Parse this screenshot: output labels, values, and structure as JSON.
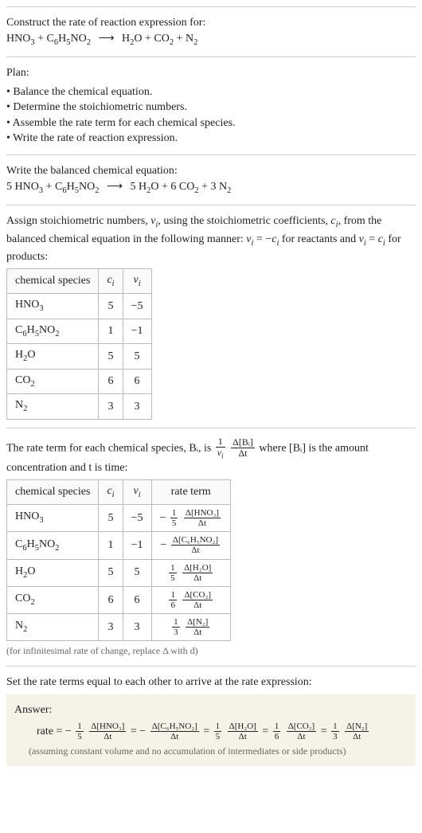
{
  "prompt": {
    "title": "Construct the rate of reaction expression for:",
    "equation": "HNO₃ + C₆H₅NO₂ ⟶ H₂O + CO₂ + N₂"
  },
  "plan": {
    "heading": "Plan:",
    "steps": [
      "Balance the chemical equation.",
      "Determine the stoichiometric numbers.",
      "Assemble the rate term for each chemical species.",
      "Write the rate of reaction expression."
    ]
  },
  "balanced": {
    "heading": "Write the balanced chemical equation:",
    "equation": "5 HNO₃ + C₆H₅NO₂ ⟶ 5 H₂O + 6 CO₂ + 3 N₂"
  },
  "stoich": {
    "intro": "Assign stoichiometric numbers, νᵢ, using the stoichiometric coefficients, cᵢ, from the balanced chemical equation in the following manner: νᵢ = −cᵢ for reactants and νᵢ = cᵢ for products:",
    "headers": {
      "species": "chemical species",
      "c": "cᵢ",
      "nu": "νᵢ"
    },
    "rows": [
      {
        "species": "HNO₃",
        "c": "5",
        "nu": "−5"
      },
      {
        "species": "C₆H₅NO₂",
        "c": "1",
        "nu": "−1"
      },
      {
        "species": "H₂O",
        "c": "5",
        "nu": "5"
      },
      {
        "species": "CO₂",
        "c": "6",
        "nu": "6"
      },
      {
        "species": "N₂",
        "c": "3",
        "nu": "3"
      }
    ]
  },
  "rateTerms": {
    "intro_pre": "The rate term for each chemical species, Bᵢ, is ",
    "intro_post": " where [Bᵢ] is the amount concentration and t is time:",
    "headers": {
      "species": "chemical species",
      "c": "cᵢ",
      "nu": "νᵢ",
      "term": "rate term"
    },
    "rows": [
      {
        "species": "HNO₃",
        "c": "5",
        "nu": "−5",
        "sign": "−",
        "coef_num": "1",
        "coef_den": "5",
        "delta_num": "Δ[HNO₃]",
        "delta_den": "Δt"
      },
      {
        "species": "C₆H₅NO₂",
        "c": "1",
        "nu": "−1",
        "sign": "−",
        "coef_num": "",
        "coef_den": "",
        "delta_num": "Δ[C₆H₅NO₂]",
        "delta_den": "Δt"
      },
      {
        "species": "H₂O",
        "c": "5",
        "nu": "5",
        "sign": "",
        "coef_num": "1",
        "coef_den": "5",
        "delta_num": "Δ[H₂O]",
        "delta_den": "Δt"
      },
      {
        "species": "CO₂",
        "c": "6",
        "nu": "6",
        "sign": "",
        "coef_num": "1",
        "coef_den": "6",
        "delta_num": "Δ[CO₂]",
        "delta_den": "Δt"
      },
      {
        "species": "N₂",
        "c": "3",
        "nu": "3",
        "sign": "",
        "coef_num": "1",
        "coef_den": "3",
        "delta_num": "Δ[N₂]",
        "delta_den": "Δt"
      }
    ],
    "note": "(for infinitesimal rate of change, replace Δ with d)"
  },
  "final": {
    "heading": "Set the rate terms equal to each other to arrive at the rate expression:",
    "answerLabel": "Answer:",
    "rateWord": "rate",
    "terms": [
      {
        "sign": "−",
        "coef_num": "1",
        "coef_den": "5",
        "delta_num": "Δ[HNO₃]",
        "delta_den": "Δt"
      },
      {
        "sign": "−",
        "coef_num": "",
        "coef_den": "",
        "delta_num": "Δ[C₆H₅NO₂]",
        "delta_den": "Δt"
      },
      {
        "sign": "",
        "coef_num": "1",
        "coef_den": "5",
        "delta_num": "Δ[H₂O]",
        "delta_den": "Δt"
      },
      {
        "sign": "",
        "coef_num": "1",
        "coef_den": "6",
        "delta_num": "Δ[CO₂]",
        "delta_den": "Δt"
      },
      {
        "sign": "",
        "coef_num": "1",
        "coef_den": "3",
        "delta_num": "Δ[N₂]",
        "delta_den": "Δt"
      }
    ],
    "assumption": "(assuming constant volume and no accumulation of intermediates or side products)"
  },
  "glyphs": {
    "nu": "ν",
    "deltaBi": "Δ[Bᵢ]",
    "deltaT": "Δt",
    "one": "1",
    "eq": "="
  }
}
